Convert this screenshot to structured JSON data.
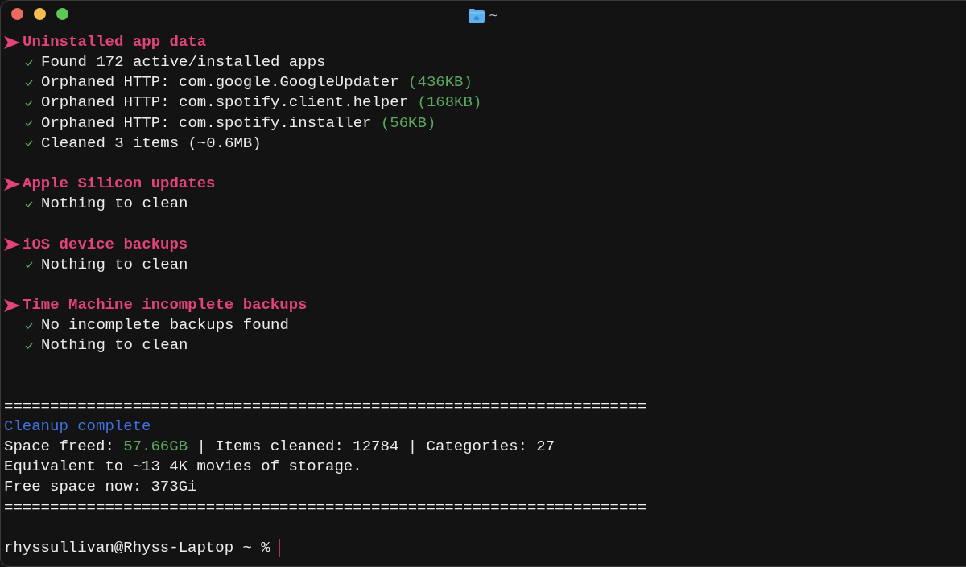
{
  "window": {
    "title": "~"
  },
  "sections": [
    {
      "title": "Uninstalled app data",
      "lines": [
        {
          "text": "Found 172 active/installed apps"
        },
        {
          "text": "Orphaned HTTP: com.google.GoogleUpdater",
          "size": "(436KB)"
        },
        {
          "text": "Orphaned HTTP: com.spotify.client.helper",
          "size": "(168KB)"
        },
        {
          "text": "Orphaned HTTP: com.spotify.installer",
          "size": "(56KB)"
        },
        {
          "text": "Cleaned 3 items (~0.6MB)"
        }
      ]
    },
    {
      "title": "Apple Silicon updates",
      "lines": [
        {
          "text": "Nothing to clean"
        }
      ]
    },
    {
      "title": "iOS device backups",
      "lines": [
        {
          "text": "Nothing to clean"
        }
      ]
    },
    {
      "title": "Time Machine incomplete backups",
      "lines": [
        {
          "text": "No incomplete backups found"
        },
        {
          "text": "Nothing to clean"
        }
      ]
    }
  ],
  "summary": [
    {
      "kind": "rule",
      "text": "======================================================================"
    },
    {
      "kind": "title",
      "text": "Cleanup complete"
    },
    {
      "kind": "stats",
      "label": "Space freed:",
      "value": "57.66GB",
      "rest": "| Items cleaned: 12784 | Categories: 27"
    },
    {
      "kind": "plain",
      "text": "Equivalent to ~13 4K movies of storage."
    },
    {
      "kind": "plain",
      "text": "Free space now: 373Gi"
    },
    {
      "kind": "rule",
      "text": "======================================================================"
    }
  ],
  "prompt": {
    "text": "rhyssullivan@Rhyss-Laptop ~ %"
  }
}
